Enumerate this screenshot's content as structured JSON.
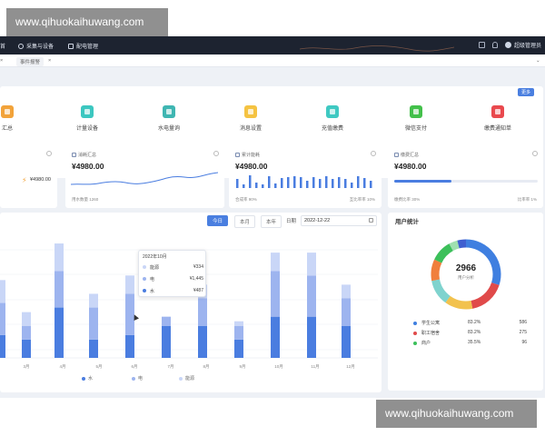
{
  "watermarks": {
    "top": "www.qihuokaihuwang.com",
    "bottom": "www.qihuokaihuwang.com"
  },
  "topbar": {
    "nav": [
      {
        "label": "首"
      },
      {
        "label": "采集与设备"
      },
      {
        "label": "配电管理"
      }
    ],
    "user": "超级管理员"
  },
  "tabs": {
    "active": "事件报警"
  },
  "quick_entries": {
    "more_label": "更多",
    "items": [
      {
        "label": "汇总",
        "color": "#f2a33a"
      },
      {
        "label": "计量设备",
        "color": "#3cc7c0"
      },
      {
        "label": "水电量询",
        "color": "#3fb6b2"
      },
      {
        "label": "消息设置",
        "color": "#f5c342"
      },
      {
        "label": "充值缴费",
        "color": "#3fc9c2"
      },
      {
        "label": "微信支付",
        "color": "#43c04a"
      },
      {
        "label": "缴费通知单",
        "color": "#e9494e"
      }
    ]
  },
  "stats": [
    {
      "title": "",
      "value": "¥4980.00",
      "foot_left": "",
      "foot_right": ""
    },
    {
      "title": "消耗汇总",
      "value": "¥4980.00",
      "foot_left": "用水数量  1260",
      "foot_right": ""
    },
    {
      "title": "累计能耗",
      "value": "¥4980.00",
      "foot_left": "合成率  90%",
      "foot_right": "互比率率  10%"
    },
    {
      "title": "缴费汇总",
      "value": "¥4980.00",
      "foot_left": "缴费比率  30%",
      "foot_right": "比率率  1%"
    }
  ],
  "chart_controls": {
    "today": "今日",
    "month": "本月",
    "year": "本年",
    "date_label": "日期",
    "date_value": "2022-12-22"
  },
  "chart_data": {
    "type": "bar",
    "categories": [
      "",
      "3月",
      "4月",
      "5月",
      "6月",
      "7月",
      "8月",
      "9月",
      "10月",
      "11月",
      "12月"
    ],
    "series": [
      {
        "name": "水",
        "values": [
          25,
          20,
          55,
          20,
          25,
          35,
          35,
          20,
          45,
          45,
          35
        ]
      },
      {
        "name": "电",
        "values": [
          35,
          15,
          40,
          35,
          45,
          10,
          30,
          15,
          50,
          45,
          30
        ]
      },
      {
        "name": "能源",
        "values": [
          25,
          15,
          30,
          15,
          20,
          0,
          15,
          5,
          20,
          25,
          15
        ]
      }
    ],
    "ylim": [
      0,
      130
    ],
    "colors": [
      "#4a7de0",
      "#9db4ef",
      "#c9d6f7"
    ],
    "legend_position": "bottom"
  },
  "tooltip": {
    "title": "2022年10月",
    "rows": [
      {
        "name": "能源",
        "value": "¥334"
      },
      {
        "name": "电",
        "value": "¥1,445"
      },
      {
        "name": "水",
        "value": "¥487"
      }
    ]
  },
  "user_stats": {
    "title": "用户统计",
    "total": "2966",
    "total_label": "用户分析",
    "donut": [
      {
        "color": "#3f7fe0",
        "value": 30
      },
      {
        "color": "#e04a4a",
        "value": 17
      },
      {
        "color": "#f2c24e",
        "value": 13
      },
      {
        "color": "#7fd3ce",
        "value": 12
      },
      {
        "color": "#f07f3c",
        "value": 10
      },
      {
        "color": "#3cc05a",
        "value": 10
      },
      {
        "color": "#9fe0b0",
        "value": 4
      },
      {
        "color": "#3f5fd0",
        "value": 4
      }
    ],
    "rows": [
      {
        "name": "学生公寓",
        "pct": "83.2%",
        "count": "586",
        "color": "#3f7fe0"
      },
      {
        "name": "职工宿舍",
        "pct": "83.2%",
        "count": "275",
        "color": "#e04a4a"
      },
      {
        "name": "商户",
        "pct": "35.5%",
        "count": "96",
        "color": "#3cc05a"
      }
    ]
  }
}
